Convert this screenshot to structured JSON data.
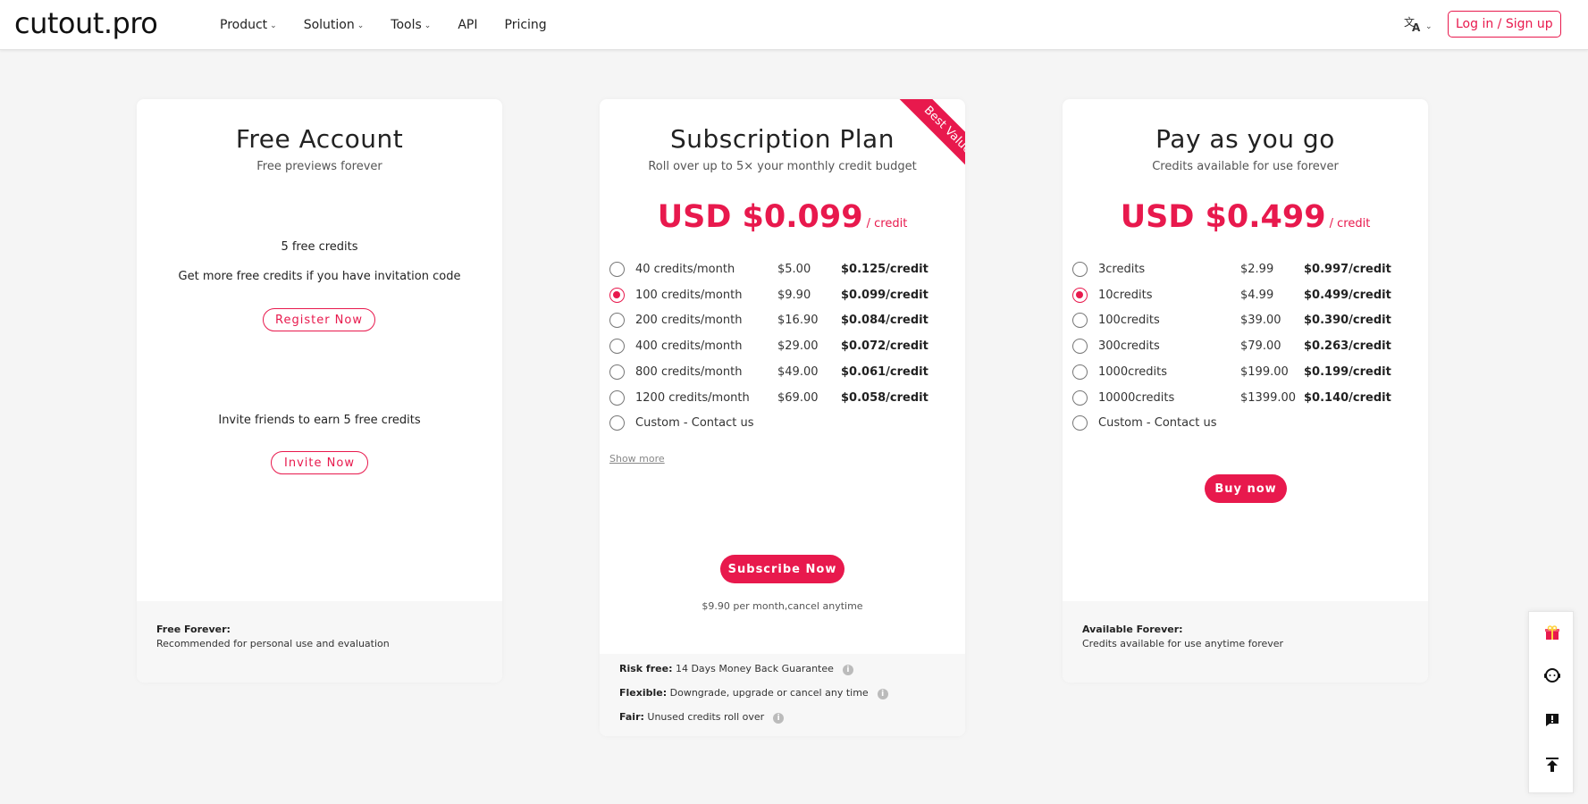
{
  "header": {
    "logo": "cutout.pro",
    "nav": [
      {
        "label": "Product",
        "has_dropdown": true
      },
      {
        "label": "Solution",
        "has_dropdown": true
      },
      {
        "label": "Tools",
        "has_dropdown": true
      },
      {
        "label": "API",
        "has_dropdown": false
      },
      {
        "label": "Pricing",
        "has_dropdown": false
      }
    ],
    "language_icon": "translate-icon",
    "login_label": "Log in / Sign up"
  },
  "free": {
    "title": "Free Account",
    "subtitle": "Free previews forever",
    "credits_text": "5 free credits",
    "invite_code_text": "Get more free credits if you have invitation code",
    "register_label": "Register Now",
    "invite_text": "Invite friends to earn 5 free credits",
    "invite_label": "Invite Now",
    "footer_title": "Free Forever:",
    "footer_text": "Recommended for personal use and evaluation"
  },
  "subscription": {
    "ribbon": "Best Value",
    "title": "Subscription Plan",
    "subtitle": "Roll over up to 5× your monthly credit budget",
    "price": "USD $0.099",
    "price_unit": "/ credit",
    "options": [
      {
        "label": "40 credits/month",
        "amount": "$5.00",
        "per": "$0.125/credit",
        "selected": false
      },
      {
        "label": "100 credits/month",
        "amount": "$9.90",
        "per": "$0.099/credit",
        "selected": true
      },
      {
        "label": "200 credits/month",
        "amount": "$16.90",
        "per": "$0.084/credit",
        "selected": false
      },
      {
        "label": "400 credits/month",
        "amount": "$29.00",
        "per": "$0.072/credit",
        "selected": false
      },
      {
        "label": "800 credits/month",
        "amount": "$49.00",
        "per": "$0.061/credit",
        "selected": false
      },
      {
        "label": "1200 credits/month",
        "amount": "$69.00",
        "per": "$0.058/credit",
        "selected": false
      },
      {
        "label": "Custom - Contact us",
        "amount": "",
        "per": "",
        "selected": false
      }
    ],
    "show_more": "Show more",
    "button": "Subscribe Now",
    "note": "$9.90 per month,cancel anytime",
    "footer": [
      {
        "key": "Risk free:",
        "text": "14 Days Money Back Guarantee"
      },
      {
        "key": "Flexible:",
        "text": "Downgrade, upgrade or cancel any time"
      },
      {
        "key": "Fair:",
        "text": "Unused credits roll over"
      }
    ]
  },
  "payg": {
    "title": "Pay as you go",
    "subtitle": "Credits available for use forever",
    "price": "USD $0.499",
    "price_unit": "/ credit",
    "options": [
      {
        "label": "3credits",
        "amount": "$2.99",
        "per": "$0.997/credit",
        "selected": false
      },
      {
        "label": "10credits",
        "amount": "$4.99",
        "per": "$0.499/credit",
        "selected": true
      },
      {
        "label": "100credits",
        "amount": "$39.00",
        "per": "$0.390/credit",
        "selected": false
      },
      {
        "label": "300credits",
        "amount": "$79.00",
        "per": "$0.263/credit",
        "selected": false
      },
      {
        "label": "1000credits",
        "amount": "$199.00",
        "per": "$0.199/credit",
        "selected": false
      },
      {
        "label": "10000credits",
        "amount": "$1399.00",
        "per": "$0.140/credit",
        "selected": false
      },
      {
        "label": "Custom - Contact us",
        "amount": "",
        "per": "",
        "selected": false
      }
    ],
    "button": "Buy now",
    "footer_title": "Available Forever:",
    "footer_text": "Credits available for use anytime forever"
  },
  "side_tools": [
    "gift-icon",
    "support-agent-icon",
    "feedback-icon",
    "back-to-top-icon"
  ],
  "colors": {
    "accent": "#e8194d",
    "background": "#f5f5f5"
  }
}
